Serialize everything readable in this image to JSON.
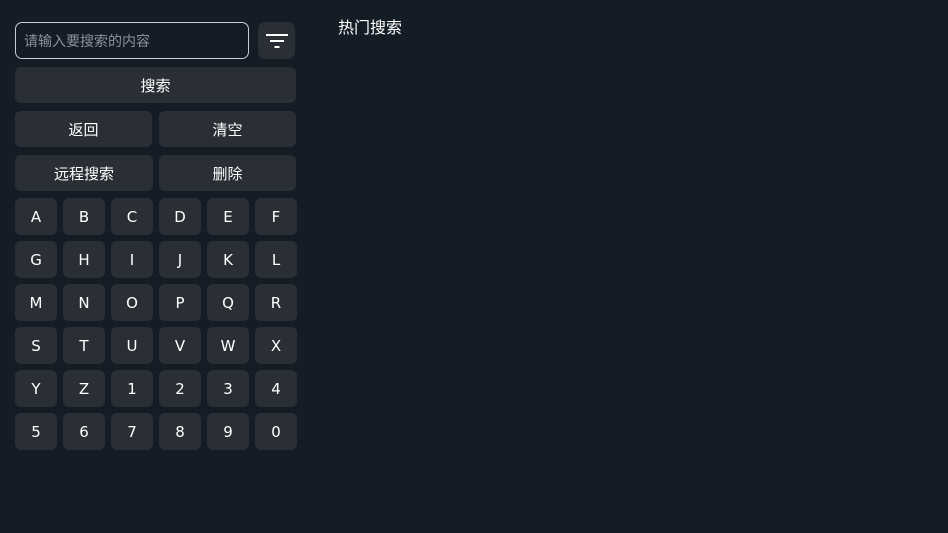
{
  "search": {
    "placeholder": "请输入要搜索的内容",
    "value": ""
  },
  "filter": {
    "icon": "filter-icon"
  },
  "actions": {
    "search_label": "搜索",
    "back_label": "返回",
    "clear_label": "清空",
    "remote_search_label": "远程搜索",
    "delete_label": "删除"
  },
  "keyboard": {
    "keys": [
      "A",
      "B",
      "C",
      "D",
      "E",
      "F",
      "G",
      "H",
      "I",
      "J",
      "K",
      "L",
      "M",
      "N",
      "O",
      "P",
      "Q",
      "R",
      "S",
      "T",
      "U",
      "V",
      "W",
      "X",
      "Y",
      "Z",
      "1",
      "2",
      "3",
      "4",
      "5",
      "6",
      "7",
      "8",
      "9",
      "0"
    ]
  },
  "hot": {
    "title": "热门搜索"
  },
  "colors": {
    "background": "#141c26",
    "button": "#2a2f35",
    "input_border": "#c9ccd1",
    "text": "#ffffff"
  }
}
